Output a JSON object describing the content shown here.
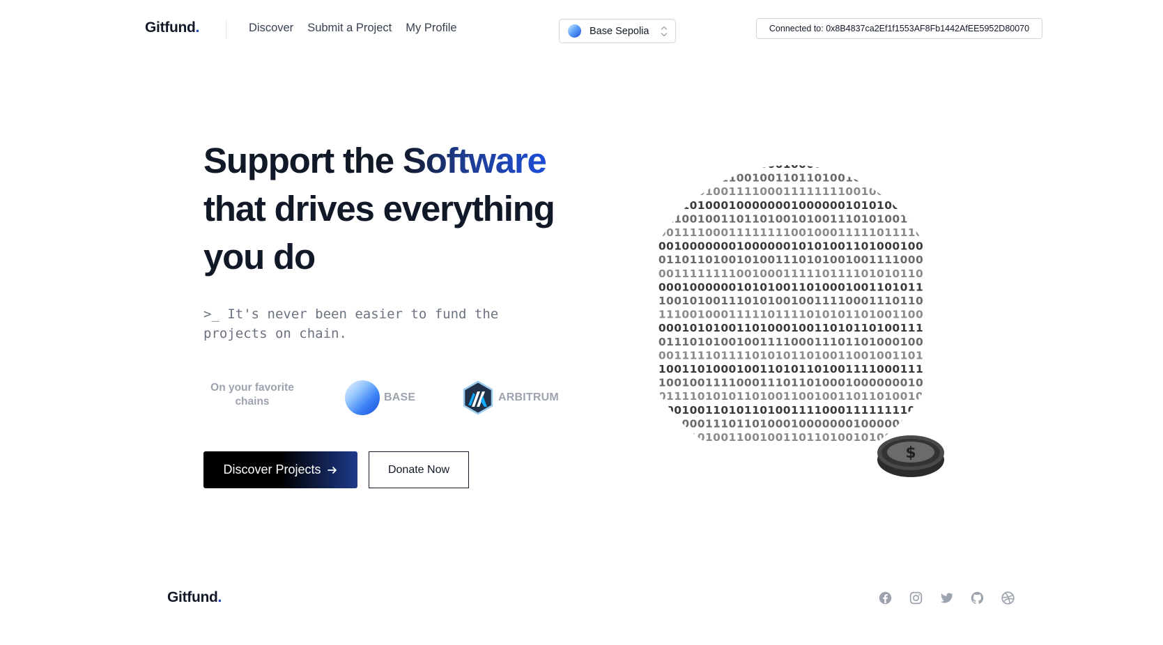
{
  "header": {
    "logo": {
      "text": "Gitfund",
      "dot": "."
    },
    "nav": [
      {
        "label": "Discover"
      },
      {
        "label": "Submit a Project"
      },
      {
        "label": "My Profile"
      }
    ],
    "network_select": {
      "selected": "Base Sepolia",
      "icon": "base-chain-icon"
    },
    "wallet": {
      "label": "Connected to: 0x8B4837ca2Ef1f1553AF8Fb1442AfEE5952D80070"
    }
  },
  "hero": {
    "headline_part1": "Support the ",
    "headline_accent": "Software",
    "headline_line2": "that drives everything",
    "headline_line3": "you do",
    "tagline": ">_ It's never been easier to fund the projects on chain.",
    "chains_label": "On your favorite chains",
    "chains": [
      {
        "name": "BASE",
        "icon": "base-logo-icon"
      },
      {
        "name": "ARBITRUM",
        "icon": "arbitrum-logo-icon"
      }
    ],
    "primary_button": "Discover Projects",
    "primary_button_icon": "arrow-right-icon",
    "secondary_button": "Donate Now",
    "illustration": {
      "icon": "binary-globe-with-coin"
    }
  },
  "footer": {
    "logo": {
      "text": "Gitfund",
      "dot": "."
    },
    "social_icons": [
      "facebook-icon",
      "instagram-icon",
      "twitter-icon",
      "github-icon",
      "dribbble-icon"
    ]
  },
  "colors": {
    "text": "#111827",
    "accent": "#1e40af",
    "muted": "#9ca3af",
    "border": "#d1d5db"
  }
}
